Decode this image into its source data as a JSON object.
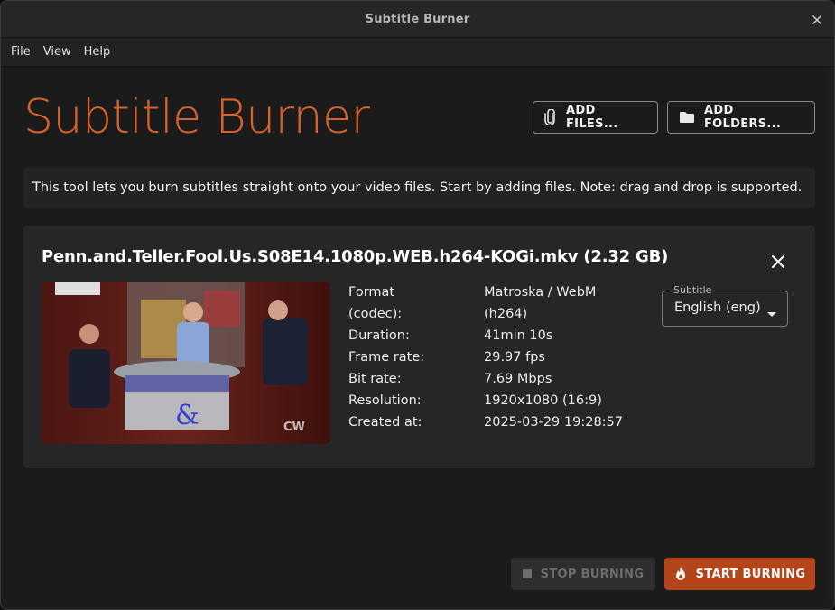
{
  "window": {
    "title": "Subtitle Burner"
  },
  "menu": {
    "items": [
      "File",
      "View",
      "Help"
    ]
  },
  "header": {
    "app_title": "Subtitle Burner",
    "add_files_label": "ADD FILES...",
    "add_folders_label": "ADD FOLDERS..."
  },
  "info": {
    "text": "This tool lets you burn subtitles straight onto your video files. Start by adding files. Note: drag and drop is supported."
  },
  "file": {
    "title": "Penn.and.Teller.Fool.Us.S08E14.1080p.WEB.h264-KOGi.mkv (2.32 GB)",
    "thumbnail_watermark": "CW",
    "meta_labels": [
      "Format",
      "(codec):",
      "Duration:",
      "Frame rate:",
      "Bit rate:",
      "Resolution:",
      "Created at:"
    ],
    "meta_values": [
      "Matroska / WebM",
      "(h264)",
      "41min 10s",
      "29.97 fps",
      "7.69 Mbps",
      "1920x1080 (16:9)",
      "2025-03-29 19:28:57"
    ],
    "subtitle": {
      "label": "Subtitle",
      "value": "English (eng)"
    }
  },
  "actions": {
    "stop_label": "STOP BURNING",
    "start_label": "START BURNING"
  },
  "colors": {
    "accent": "#d8622a",
    "start_button": "#b4451b",
    "background": "#1b1b1b",
    "card": "#262626"
  },
  "icons": {
    "close": "close-icon",
    "add_files": "paperclip-icon",
    "add_folders": "folder-icon",
    "stop": "stop-square-icon",
    "start": "flame-icon",
    "dropdown": "caret-down-icon"
  }
}
